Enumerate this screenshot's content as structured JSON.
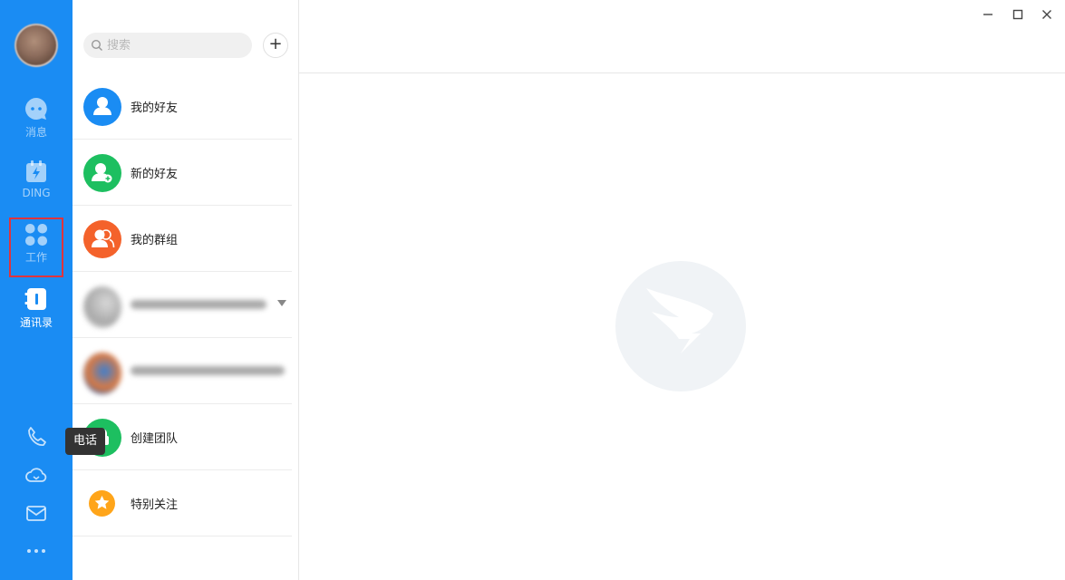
{
  "nav": {
    "items": [
      {
        "label": "消息",
        "icon": "message-icon"
      },
      {
        "label": "DING",
        "icon": "ding-icon"
      },
      {
        "label": "工作",
        "icon": "work-grid-icon"
      },
      {
        "label": "通讯录",
        "icon": "contacts-icon"
      }
    ],
    "active": "通讯录",
    "highlighted": "工作",
    "bottom": [
      "phone-icon",
      "cloud-icon",
      "mail-icon",
      "more-icon"
    ],
    "tooltip": "电话"
  },
  "panel": {
    "search_placeholder": "搜索",
    "add_label": "+",
    "rows": [
      {
        "label": "我的好友",
        "color": "#1a8cf3"
      },
      {
        "label": "新的好友",
        "color": "#1dbf60"
      },
      {
        "label": "我的群组",
        "color": "#f4622b"
      },
      {
        "label": "创建团队",
        "color": "#1dbf60"
      },
      {
        "label": "特别关注",
        "color": "#ffa51a"
      }
    ]
  },
  "colors": {
    "nav_bg": "#1a8cf3",
    "highlight_border": "#e0343c",
    "logo_bg": "#f0f3f6"
  }
}
